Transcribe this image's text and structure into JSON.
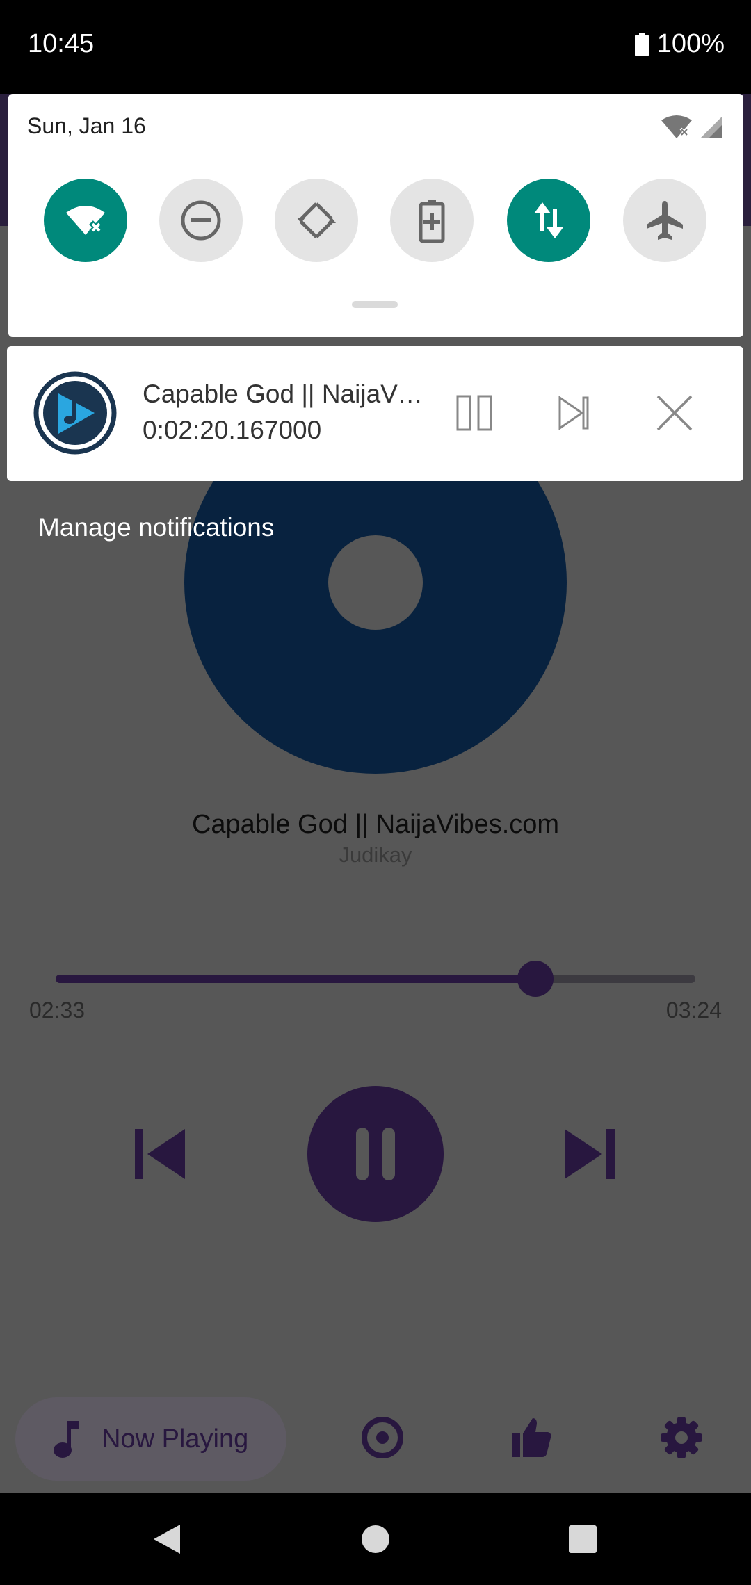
{
  "status_bar": {
    "time": "10:45",
    "battery": "100%"
  },
  "quick_settings": {
    "date": "Sun, Jan 16",
    "tiles": [
      {
        "icon": "wifi-off-icon",
        "state": "on"
      },
      {
        "icon": "do-not-disturb-icon",
        "state": "off"
      },
      {
        "icon": "auto-rotate-icon",
        "state": "off"
      },
      {
        "icon": "battery-saver-icon",
        "state": "off"
      },
      {
        "icon": "mobile-data-icon",
        "state": "on"
      },
      {
        "icon": "airplane-mode-icon",
        "state": "off"
      }
    ],
    "accent_color": "#00897b"
  },
  "notification": {
    "title": "Capable God || NaijaVibes.com",
    "position": "0:02:20.167000",
    "actions": [
      "pause-icon",
      "skip-next-icon",
      "close-icon"
    ]
  },
  "manage_notifications": "Manage notifications",
  "player": {
    "title": "Capable God || NaijaVibes.com",
    "artist": "Judikay",
    "elapsed": "02:33",
    "total": "03:24",
    "progress": 0.75,
    "accent_color": "#28173f"
  },
  "bottom_nav": {
    "now_playing": "Now Playing",
    "items": [
      "music-note-icon",
      "album-icon",
      "thumbs-up-icon",
      "settings-icon"
    ]
  },
  "system_nav": [
    "back-icon",
    "home-icon",
    "recents-icon"
  ]
}
